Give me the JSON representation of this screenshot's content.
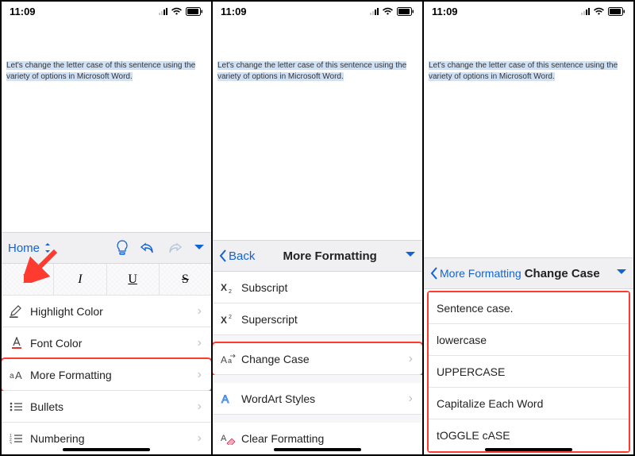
{
  "status": {
    "time": "11:09"
  },
  "document": {
    "selected_text": "Let's change the letter case of this sentence using the variety of options in Microsoft Word."
  },
  "pane1": {
    "tab_label": "Home",
    "format_buttons": {
      "bold": "B",
      "italic": "I",
      "underline": "U",
      "strike": "S"
    },
    "rows": {
      "highlight": "Highlight Color",
      "fontcolor": "Font Color",
      "moreformatting": "More Formatting",
      "bullets": "Bullets",
      "numbering": "Numbering"
    }
  },
  "pane2": {
    "back_label": "Back",
    "title": "More Formatting",
    "rows": {
      "subscript": "Subscript",
      "superscript": "Superscript",
      "changecase": "Change Case",
      "wordart": "WordArt Styles",
      "clearformatting": "Clear Formatting"
    }
  },
  "pane3": {
    "back_label": "More Formatting",
    "title": "Change Case",
    "options": {
      "sentence": "Sentence case.",
      "lower": "lowercase",
      "upper": "UPPERCASE",
      "capword": "Capitalize Each Word",
      "toggle": "tOGGLE cASE"
    }
  }
}
